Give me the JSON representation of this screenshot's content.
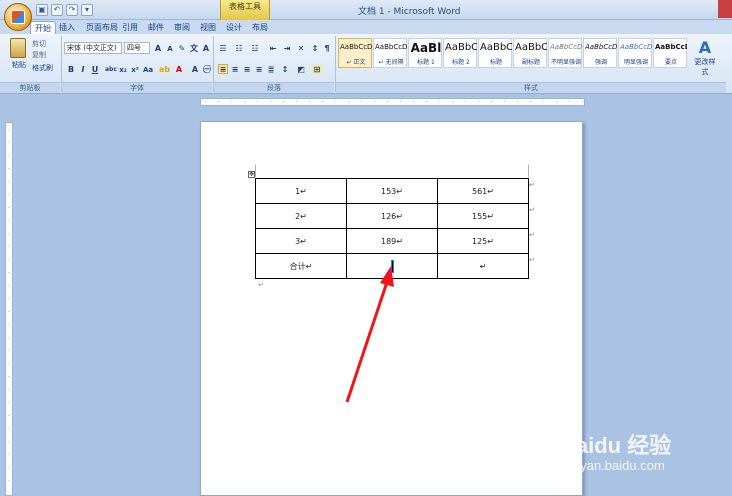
{
  "window": {
    "title": "文档 1 - Microsoft Word",
    "context_tool": "表格工具"
  },
  "tabs": [
    "开始",
    "插入",
    "页面布局",
    "引用",
    "邮件",
    "审阅",
    "视图",
    "设计",
    "布局"
  ],
  "active_tab": "开始",
  "clipboard": {
    "paste": "粘贴",
    "cut": "剪切",
    "copy": "复制",
    "format_painter": "格式刷",
    "group": "剪贴板"
  },
  "font": {
    "name": "宋体 (中文正文)",
    "size": "四号",
    "group": "字体"
  },
  "paragraph": {
    "group": "段落"
  },
  "styles": {
    "group": "样式",
    "items": [
      {
        "sample": "AaBbCcDd",
        "name": "↵ 正文",
        "selected": true
      },
      {
        "sample": "AaBbCcDd",
        "name": "↵ 无间隔"
      },
      {
        "sample": "AaBl",
        "name": "标题 1"
      },
      {
        "sample": "AaBbC",
        "name": "标题 2"
      },
      {
        "sample": "AaBbC",
        "name": "标题"
      },
      {
        "sample": "AaBbC",
        "name": "副标题"
      },
      {
        "sample": "AaBbCcDd",
        "name": "不明显强调"
      },
      {
        "sample": "AaBbCcDd",
        "name": "强调"
      },
      {
        "sample": "AaBbCcDd",
        "name": "明显强调"
      },
      {
        "sample": "AaBbCcDd",
        "name": "要点"
      }
    ],
    "change_style": "更改样式"
  },
  "table": {
    "rows": [
      [
        "1↵",
        "153↵",
        "561↵"
      ],
      [
        "2↵",
        "126↵",
        "155↵"
      ],
      [
        "3↵",
        "189↵",
        "125↵"
      ],
      [
        "合计↵",
        "",
        "↵"
      ]
    ]
  },
  "watermark": {
    "logo": "Baidu 经验",
    "url": "jingyan.baidu.com"
  }
}
